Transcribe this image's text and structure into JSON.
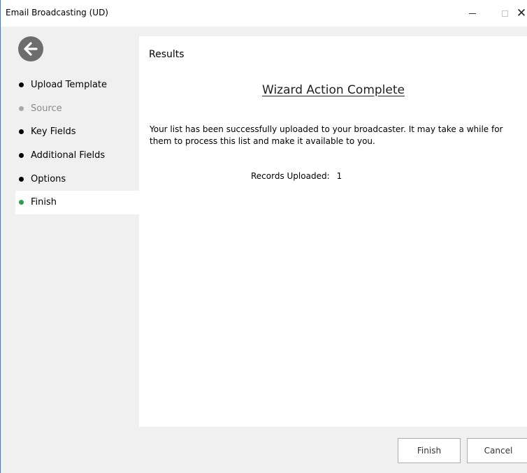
{
  "window": {
    "title": "Email Broadcasting (UD)",
    "minimize_glyph": "—",
    "maximize_glyph": "☐",
    "close_glyph": "✕"
  },
  "sidebar": {
    "back_icon": "arrow-left-icon",
    "items": [
      {
        "label": "Upload Template",
        "state": "done"
      },
      {
        "label": "Source",
        "state": "disabled"
      },
      {
        "label": "Key Fields",
        "state": "done"
      },
      {
        "label": "Additional Fields",
        "state": "done"
      },
      {
        "label": "Options",
        "state": "done"
      },
      {
        "label": "Finish",
        "state": "active"
      }
    ]
  },
  "main": {
    "section_title": "Results",
    "heading": "Wizard Action Complete",
    "message": "Your list has been successfully uploaded to your broadcaster.  It may take a while for them to process this list and make it available to you.",
    "records_label": "Records Uploaded:",
    "records_value": "1"
  },
  "footer": {
    "finish_label": "Finish",
    "cancel_label": "Cancel"
  },
  "colors": {
    "active_dot": "#2e9e4b",
    "disabled_dot": "#a8a8a8",
    "back_button": "#6d6d6d",
    "window_border": "#3c7dbf"
  }
}
